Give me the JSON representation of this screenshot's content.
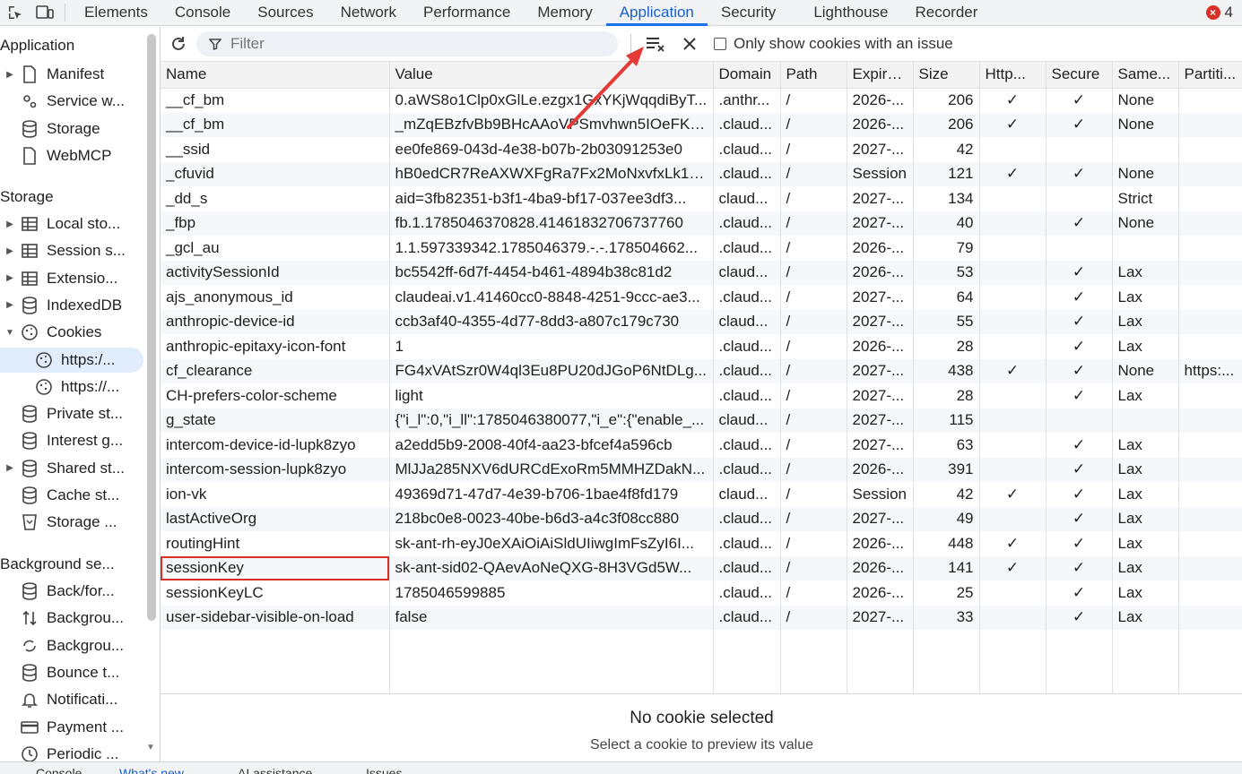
{
  "tabs": [
    "Elements",
    "Console",
    "Sources",
    "Network",
    "Performance",
    "Memory",
    "Application",
    "Security",
    "Lighthouse",
    "Recorder"
  ],
  "active_tab": "Application",
  "error_count": "4",
  "sidebar": {
    "application_title": "Application",
    "application_items": [
      "Manifest",
      "Service w...",
      "Storage",
      "WebMCP"
    ],
    "storage_title": "Storage",
    "storage_items": [
      "Local sto...",
      "Session s...",
      "Extensio...",
      "IndexedDB",
      "Cookies",
      "https:/...",
      "https://...",
      "Private st...",
      "Interest g...",
      "Shared st...",
      "Cache st...",
      "Storage ..."
    ],
    "background_title": "Background se...",
    "background_items": [
      "Back/for...",
      "Backgrou...",
      "Backgrou...",
      "Bounce t...",
      "Notificati...",
      "Payment ...",
      "Periodic ..."
    ]
  },
  "toolbar": {
    "filter_placeholder": "Filter",
    "only_issues_label": "Only show cookies with an issue"
  },
  "columns": [
    "Name",
    "Value",
    "Domain",
    "Path",
    "Expire...",
    "Size",
    "Http...",
    "Secure",
    "Same...",
    "Partiti..."
  ],
  "cookies": [
    [
      "__cf_bm",
      "0.aWS8o1Clp0xGlLe.ezgx1GxYKjWqqdiByT...",
      ".anthr...",
      "/",
      "2026-...",
      "206",
      "✓",
      "✓",
      "None",
      ""
    ],
    [
      "__cf_bm",
      "_mZqEBzfvBb9BHcAAoVPSmvhwn5IOeFKc...",
      ".claud...",
      "/",
      "2026-...",
      "206",
      "✓",
      "✓",
      "None",
      ""
    ],
    [
      "__ssid",
      "ee0fe869-043d-4e38-b07b-2b03091253e0",
      ".claud...",
      "/",
      "2027-...",
      "42",
      "",
      "",
      "",
      ""
    ],
    [
      "_cfuvid",
      "hB0edCR7ReAXWXFgRa7Fx2MoNxvfxLk1p...",
      ".claud...",
      "/",
      "Session",
      "121",
      "✓",
      "✓",
      "None",
      ""
    ],
    [
      "_dd_s",
      "aid=3fb82351-b3f1-4ba9-bf17-037ee3df3...",
      "claud...",
      "/",
      "2027-...",
      "134",
      "",
      "",
      "Strict",
      ""
    ],
    [
      "_fbp",
      "fb.1.1785046370828.41461832706737760",
      ".claud...",
      "/",
      "2027-...",
      "40",
      "",
      "✓",
      "None",
      ""
    ],
    [
      "_gcl_au",
      "1.1.597339342.1785046379.-.-.178504662...",
      ".claud...",
      "/",
      "2026-...",
      "79",
      "",
      "",
      "",
      ""
    ],
    [
      "activitySessionId",
      "bc5542ff-6d7f-4454-b461-4894b38c81d2",
      "claud...",
      "/",
      "2026-...",
      "53",
      "",
      "✓",
      "Lax",
      ""
    ],
    [
      "ajs_anonymous_id",
      "claudeai.v1.41460cc0-8848-4251-9ccc-ae3...",
      ".claud...",
      "/",
      "2027-...",
      "64",
      "",
      "✓",
      "Lax",
      ""
    ],
    [
      "anthropic-device-id",
      "ccb3af40-4355-4d77-8dd3-a807c179c730",
      "claud...",
      "/",
      "2027-...",
      "55",
      "",
      "✓",
      "Lax",
      ""
    ],
    [
      "anthropic-epitaxy-icon-font",
      "1",
      ".claud...",
      "/",
      "2026-...",
      "28",
      "",
      "✓",
      "Lax",
      ""
    ],
    [
      "cf_clearance",
      "FG4xVAtSzr0W4ql3Eu8PU20dJGoP6NtDLg...",
      ".claud...",
      "/",
      "2027-...",
      "438",
      "✓",
      "✓",
      "None",
      "https:..."
    ],
    [
      "CH-prefers-color-scheme",
      "light",
      ".claud...",
      "/",
      "2027-...",
      "28",
      "",
      "✓",
      "Lax",
      ""
    ],
    [
      "g_state",
      "{\"i_l\":0,\"i_ll\":1785046380077,\"i_e\":{\"enable_...",
      "claud...",
      "/",
      "2027-...",
      "115",
      "",
      "",
      "",
      ""
    ],
    [
      "intercom-device-id-lupk8zyo",
      "a2edd5b9-2008-40f4-aa23-bfcef4a596cb",
      ".claud...",
      "/",
      "2027-...",
      "63",
      "",
      "✓",
      "Lax",
      ""
    ],
    [
      "intercom-session-lupk8zyo",
      "MlJJa285NXV6dURCdExoRm5MMHZDakN...",
      ".claud...",
      "/",
      "2026-...",
      "391",
      "",
      "✓",
      "Lax",
      ""
    ],
    [
      "ion-vk",
      "49369d71-47d7-4e39-b706-1bae4f8fd179",
      "claud...",
      "/",
      "Session",
      "42",
      "✓",
      "✓",
      "Lax",
      ""
    ],
    [
      "lastActiveOrg",
      "218bc0e8-0023-40be-b6d3-a4c3f08cc880",
      ".claud...",
      "/",
      "2027-...",
      "49",
      "",
      "✓",
      "Lax",
      ""
    ],
    [
      "routingHint",
      "sk-ant-rh-eyJ0eXAiOiAiSldUIiwgImFsZyI6I...",
      ".claud...",
      "/",
      "2026-...",
      "448",
      "✓",
      "✓",
      "Lax",
      ""
    ],
    [
      "sessionKey",
      "sk-ant-sid02-QAevAoNeQXG-8H3VGd5W...",
      ".claud...",
      "/",
      "2026-...",
      "141",
      "✓",
      "✓",
      "Lax",
      ""
    ],
    [
      "sessionKeyLC",
      "1785046599885",
      ".claud...",
      "/",
      "2026-...",
      "25",
      "",
      "✓",
      "Lax",
      ""
    ],
    [
      "user-sidebar-visible-on-load",
      "false",
      ".claud...",
      "/",
      "2027-...",
      "33",
      "",
      "✓",
      "Lax",
      ""
    ]
  ],
  "preview": {
    "title": "No cookie selected",
    "subtitle": "Select a cookie to preview its value"
  },
  "bottom_tabs": [
    "Console",
    "What's new",
    "AI assistance",
    "Issues"
  ],
  "colors": {
    "accent": "#1a73e8",
    "annotation": "#e53935"
  }
}
